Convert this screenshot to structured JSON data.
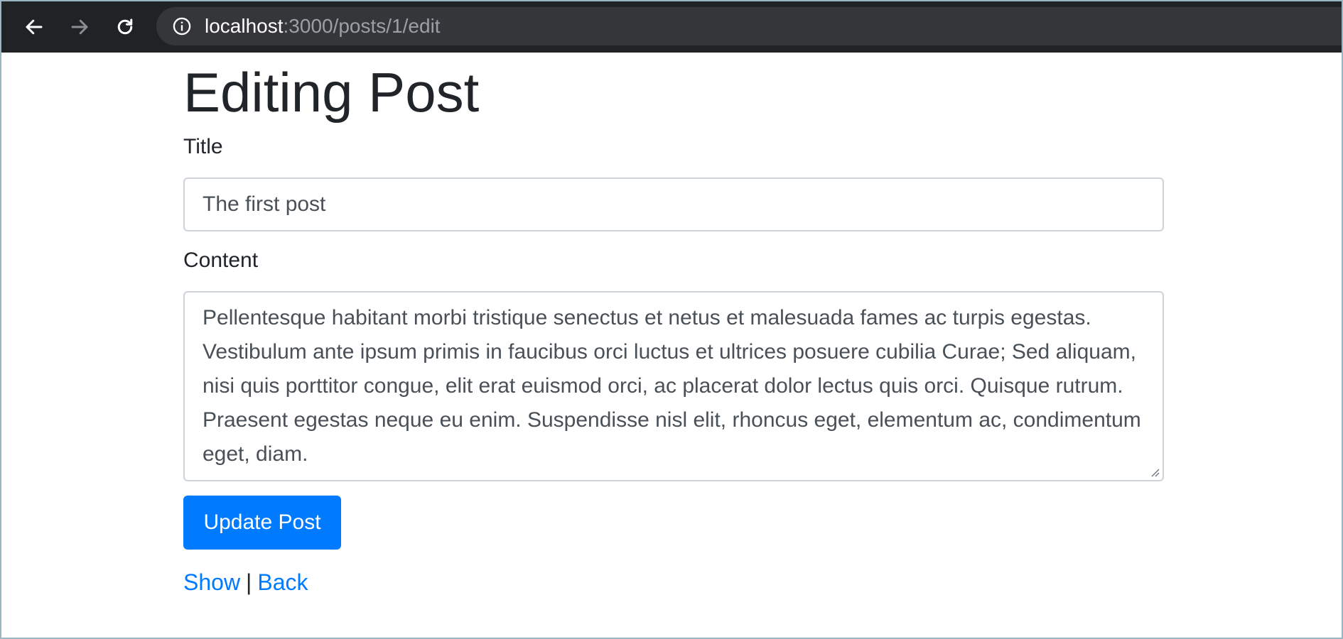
{
  "browser": {
    "url_host": "localhost",
    "url_path": ":3000/posts/1/edit"
  },
  "page": {
    "heading": "Editing Post",
    "title_label": "Title",
    "title_value": "The first post",
    "content_label": "Content",
    "content_value": "Pellentesque habitant morbi tristique senectus et netus et malesuada fames ac turpis egestas. Vestibulum ante ipsum primis in faucibus orci luctus et ultrices posuere cubilia Curae; Sed aliquam, nisi quis porttitor congue, elit erat euismod orci, ac placerat dolor lectus quis orci. Quisque rutrum. Praesent egestas neque eu enim. Suspendisse nisl elit, rhoncus eget, elementum ac, condimentum eget, diam.",
    "submit_label": "Update Post",
    "show_link": "Show",
    "separator": "|",
    "back_link": "Back"
  },
  "icons": {
    "back": "arrow-left-icon",
    "forward": "arrow-right-icon",
    "reload": "reload-icon",
    "info": "info-circle-icon"
  },
  "colors": {
    "primary": "#007bff",
    "toolbar": "#202326",
    "text": "#212529"
  }
}
